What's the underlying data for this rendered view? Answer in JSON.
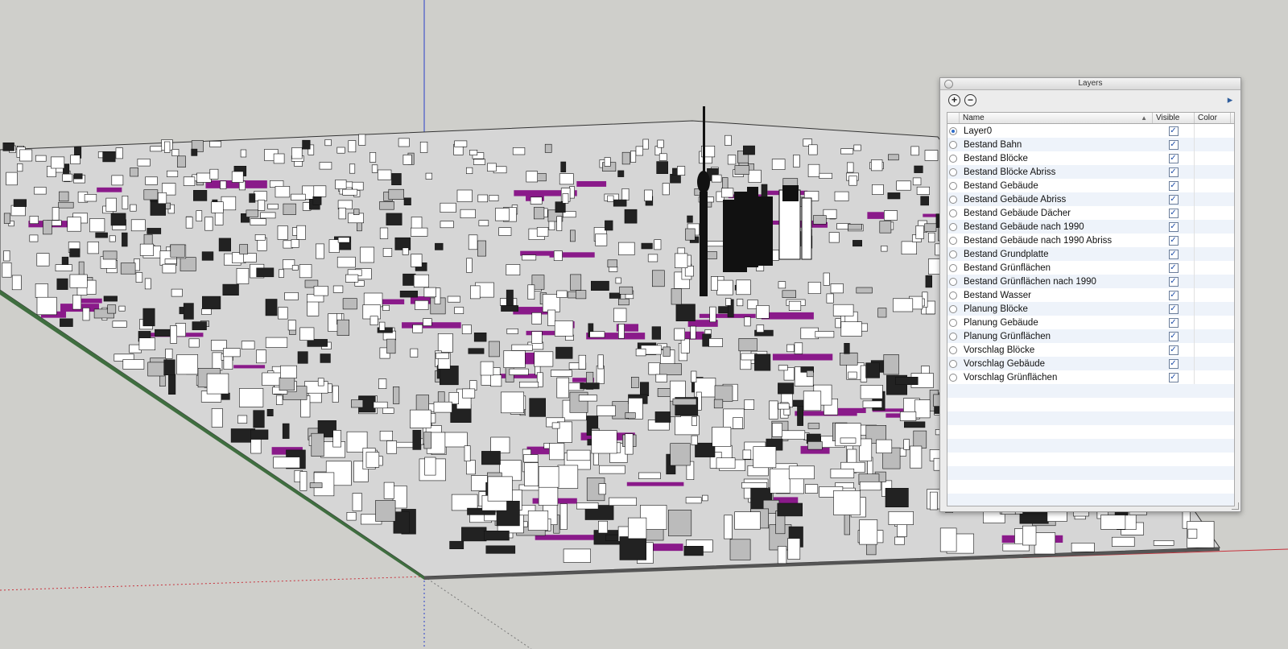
{
  "layers_panel": {
    "title": "Layers",
    "add_symbol": "+",
    "remove_symbol": "−",
    "details_symbol": "▸",
    "columns": {
      "name": "Name",
      "visible": "Visible",
      "color": "Color"
    },
    "sort_indicator": "▲",
    "rows": [
      {
        "name": "Layer0",
        "active": true,
        "visible": true
      },
      {
        "name": "Bestand Bahn",
        "active": false,
        "visible": true
      },
      {
        "name": "Bestand Blöcke",
        "active": false,
        "visible": true
      },
      {
        "name": "Bestand Blöcke Abriss",
        "active": false,
        "visible": true
      },
      {
        "name": "Bestand Gebäude",
        "active": false,
        "visible": true
      },
      {
        "name": "Bestand Gebäude Abriss",
        "active": false,
        "visible": true
      },
      {
        "name": "Bestand Gebäude Dächer",
        "active": false,
        "visible": true
      },
      {
        "name": "Bestand Gebäude nach 1990",
        "active": false,
        "visible": true
      },
      {
        "name": "Bestand Gebäude nach 1990 Abriss",
        "active": false,
        "visible": true
      },
      {
        "name": "Bestand Grundplatte",
        "active": false,
        "visible": true
      },
      {
        "name": "Bestand Grünflächen",
        "active": false,
        "visible": true
      },
      {
        "name": "Bestand Grünflächen nach 1990",
        "active": false,
        "visible": true
      },
      {
        "name": "Bestand Wasser",
        "active": false,
        "visible": true
      },
      {
        "name": "Planung Blöcke",
        "active": false,
        "visible": true
      },
      {
        "name": "Planung Gebäude",
        "active": false,
        "visible": true
      },
      {
        "name": "Planung Grünflächen",
        "active": false,
        "visible": true
      },
      {
        "name": "Vorschlag Blöcke",
        "active": false,
        "visible": true
      },
      {
        "name": "Vorschlag Gebäude",
        "active": false,
        "visible": true
      },
      {
        "name": "Vorschlag Grünflächen",
        "active": false,
        "visible": true
      }
    ]
  },
  "viewport": {
    "background_color": "#cfcfcb",
    "accent_color": "#8a1a8a",
    "axis_colors": {
      "red": "#c8323c",
      "green": "#2e8b3a",
      "blue": "#2b3fc8"
    }
  }
}
